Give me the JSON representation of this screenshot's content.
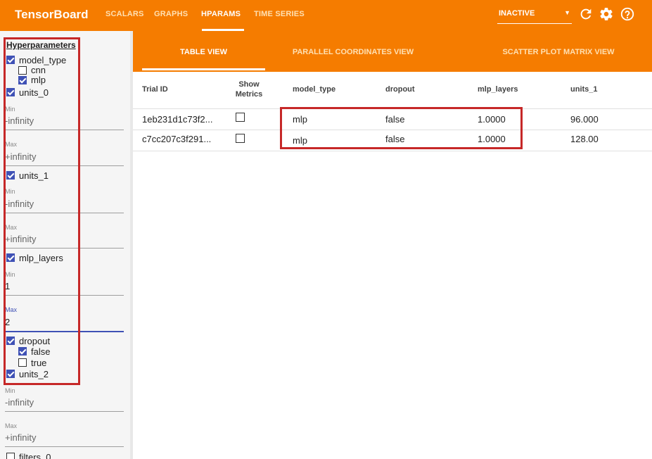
{
  "app": {
    "brand": "TensorBoard",
    "nav_tabs": [
      "SCALARS",
      "GRAPHS",
      "HPARAMS",
      "TIME SERIES"
    ],
    "active_tab": "HPARAMS",
    "status": "INACTIVE",
    "icons": [
      "refresh-icon",
      "settings-icon",
      "help-icon"
    ]
  },
  "sidebar": {
    "title": "Hyperparameters",
    "model_type": {
      "label": "model_type",
      "checked": true,
      "options": [
        {
          "label": "cnn",
          "checked": false
        },
        {
          "label": "mlp",
          "checked": true
        }
      ]
    },
    "units_0": {
      "label": "units_0",
      "checked": true,
      "min_label": "Min",
      "min_value": "-infinity",
      "max_label": "Max",
      "max_value": "+infinity"
    },
    "units_1": {
      "label": "units_1",
      "checked": true,
      "min_label": "Min",
      "min_value": "-infinity",
      "max_label": "Max",
      "max_value": "+infinity"
    },
    "mlp_layers": {
      "label": "mlp_layers",
      "checked": true,
      "min_label": "Min",
      "min_value": "1",
      "max_label": "Max",
      "max_value": "2"
    },
    "dropout": {
      "label": "dropout",
      "checked": true,
      "options": [
        {
          "label": "false",
          "checked": true
        },
        {
          "label": "true",
          "checked": false
        }
      ]
    },
    "units_2": {
      "label": "units_2",
      "checked": true,
      "min_label": "Min",
      "min_value": "-infinity",
      "max_label": "Max",
      "max_value": "+infinity"
    },
    "filters_0": {
      "label": "filters_0",
      "checked": false
    }
  },
  "view_tabs": [
    "TABLE VIEW",
    "PARALLEL COORDINATES VIEW",
    "SCATTER PLOT MATRIX VIEW"
  ],
  "active_view": "TABLE VIEW",
  "table": {
    "headers": [
      "Trial ID",
      "Show Metrics",
      "model_type",
      "dropout",
      "mlp_layers",
      "units_1"
    ],
    "rows": [
      {
        "trial_id": "1eb231d1c73f2...",
        "show_metrics": false,
        "model_type": "mlp",
        "dropout": "false",
        "mlp_layers": "1.0000",
        "units_1": "96.000"
      },
      {
        "trial_id": "c7cc207c3f291...",
        "show_metrics": false,
        "model_type": "mlp",
        "dropout": "false",
        "mlp_layers": "1.0000",
        "units_1": "128.00"
      }
    ]
  },
  "colors": {
    "header": "#f57c00",
    "accent": "#3f51b5",
    "highlight": "#c62828"
  }
}
